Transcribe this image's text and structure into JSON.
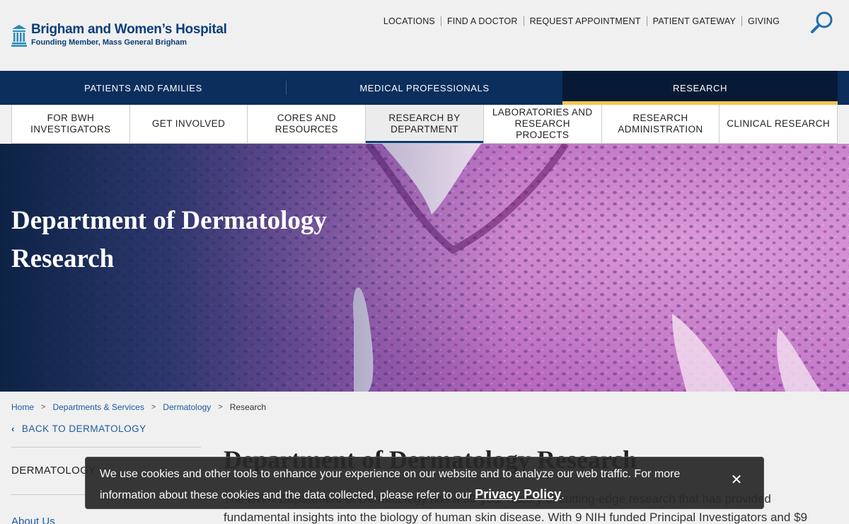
{
  "header": {
    "brand_name": "Brigham and Women’s Hospital",
    "brand_tagline": "Founding Member, Mass General Brigham",
    "utility_links": [
      "LOCATIONS",
      "FIND A DOCTOR",
      "REQUEST APPOINTMENT",
      "PATIENT GATEWAY",
      "GIVING"
    ],
    "search_icon": "search-icon"
  },
  "primary_nav": {
    "items": [
      "PATIENTS AND FAMILIES",
      "MEDICAL PROFESSIONALS",
      "RESEARCH"
    ],
    "active": "RESEARCH"
  },
  "secondary_nav": {
    "items": [
      "FOR BWH INVESTIGATORS",
      "GET INVOLVED",
      "CORES AND RESOURCES",
      "RESEARCH BY DEPARTMENT",
      "LABORATORIES AND RESEARCH PROJECTS",
      "RESEARCH ADMINISTRATION",
      "CLINICAL RESEARCH"
    ],
    "active": "RESEARCH BY DEPARTMENT"
  },
  "hero": {
    "title_line1": "Department of Dermatology",
    "title_line2": "Research"
  },
  "breadcrumb": {
    "home": "Home",
    "departments": "Departments & Services",
    "dermatology": "Dermatology",
    "current": "Research",
    "separator": ">"
  },
  "sidebar": {
    "back_label": "BACK TO DERMATOLOGY",
    "heading": "DERMATOLOGY",
    "first_link": "About Us"
  },
  "main": {
    "title": "Department of Dermatology Research",
    "body": "The BWH Department of Dermatology has a 30-year history of cutting-edge research that has provided fundamental insights into the biology of human skin disease. With 9 NIH funded Principal Investigators and $9"
  },
  "cookie_banner": {
    "text": "We use cookies and other tools to enhance your experience on our website and to analyze our web traffic. For more information about these cookies and the data collected, please refer to our ",
    "policy_link": "Privacy Policy",
    "after": ".",
    "close": "✕"
  },
  "colors": {
    "brand_navy": "#0b2e5c",
    "link_blue": "#1f5aa0",
    "active_underline": "#f5c74a"
  }
}
